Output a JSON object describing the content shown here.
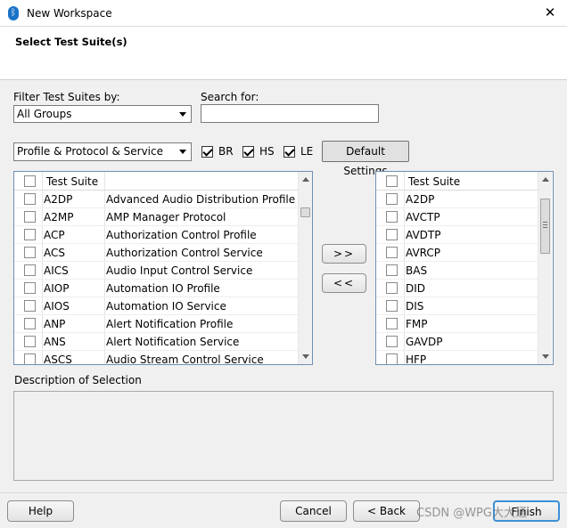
{
  "window": {
    "title": "New Workspace",
    "close_glyph": "✕",
    "app_icon": "bluetooth-icon",
    "app_icon_glyph": "ᛒ"
  },
  "header": {
    "title": "Select Test Suite(s)"
  },
  "filter": {
    "label": "Filter Test Suites by:",
    "selected": "All Groups",
    "search_label": "Search for:",
    "search_value": ""
  },
  "category": {
    "selected": "Profile & Protocol & Service",
    "options": [
      {
        "label": "BR",
        "checked": true
      },
      {
        "label": "HS",
        "checked": true
      },
      {
        "label": "LE",
        "checked": true
      }
    ],
    "default_button": "Default Settings"
  },
  "available": {
    "header": "Test Suite",
    "rows": [
      {
        "code": "A2DP",
        "name": "Advanced Audio Distribution Profile"
      },
      {
        "code": "A2MP",
        "name": "AMP Manager Protocol"
      },
      {
        "code": "ACP",
        "name": "Authorization Control Profile"
      },
      {
        "code": "ACS",
        "name": "Authorization Control Service"
      },
      {
        "code": "AICS",
        "name": "Audio Input Control Service"
      },
      {
        "code": "AIOP",
        "name": "Automation IO Profile"
      },
      {
        "code": "AIOS",
        "name": "Automation IO Service"
      },
      {
        "code": "ANP",
        "name": "Alert Notification Profile"
      },
      {
        "code": "ANS",
        "name": "Alert Notification Service"
      },
      {
        "code": "ASCS",
        "name": "Audio Stream Control Service"
      }
    ]
  },
  "transfer": {
    "add": ">>",
    "remove": "<<"
  },
  "selected_list": {
    "header": "Test Suite",
    "rows": [
      "A2DP",
      "AVCTP",
      "AVDTP",
      "AVRCP",
      "BAS",
      "DID",
      "DIS",
      "FMP",
      "GAVDP",
      "HFP"
    ]
  },
  "description": {
    "label": "Description of Selection"
  },
  "footer": {
    "help": "Help",
    "cancel": "Cancel",
    "back": "< Back",
    "finish": "Finish"
  },
  "watermark": "CSDN @WPG大大通"
}
